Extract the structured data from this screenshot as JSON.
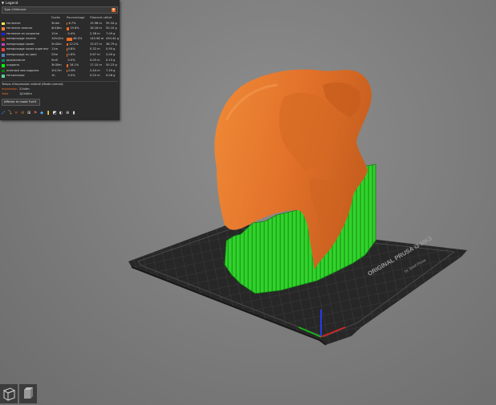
{
  "legend": {
    "title": "Legend",
    "view_type": "Type d'élément",
    "columns": {
      "time": "Durée",
      "percent": "Pourcentage",
      "length": "Filament utilisé"
    },
    "rows": [
      {
        "name": "Périmètre",
        "color": "#ffe64d",
        "time": "3h4m",
        "percent": "6.7%",
        "bar": 0.067,
        "length": "19.98 m",
        "weight": "59.34 g"
      },
      {
        "name": "Périmètre externe",
        "color": "#ff7d38",
        "time": "4h18m",
        "percent": "19.6%",
        "bar": 0.196,
        "length": "16.16 m",
        "weight": "50.10 g"
      },
      {
        "name": "Périmètre en surplomb",
        "color": "#1f1fff",
        "time": "12m",
        "percent": "0.4%",
        "bar": 0.004,
        "length": "2.38 m",
        "weight": "7.09 g"
      },
      {
        "name": "Remplissage interne",
        "color": "#b03029",
        "time": "10h12m",
        "percent": "46.5%",
        "bar": 0.465,
        "length": "145.56 m",
        "weight": "434.44 g"
      },
      {
        "name": "Remplissage solide",
        "color": "#d23cd2",
        "time": "2h42m",
        "percent": "12.2%",
        "bar": 0.122,
        "length": "13.07 m",
        "weight": "38.79 g"
      },
      {
        "name": "Remplissage solide supérieur",
        "color": "#f04040",
        "time": "11m",
        "percent": "0.8%",
        "bar": 0.008,
        "length": "0.32 m",
        "weight": "0.95 g"
      },
      {
        "name": "Remplissage du pont",
        "color": "#4d80ba",
        "time": "23m",
        "percent": "1.8%",
        "bar": 0.018,
        "length": "0.67 m",
        "weight": "2.00 g"
      },
      {
        "name": "Jupe/Bordure",
        "color": "#00876e",
        "time": "5m5",
        "percent": "0.0%",
        "bar": 0.0,
        "length": "0.05 m",
        "weight": "0.15 g"
      },
      {
        "name": "Supports",
        "color": "#00ff00",
        "time": "3h30m",
        "percent": "16.1%",
        "bar": 0.161,
        "length": "17.10 m",
        "weight": "50.23 g"
      },
      {
        "name": "Interface des supports",
        "color": "#008000",
        "time": "1h17m",
        "percent": "2.8%",
        "bar": 0.028,
        "length": "2.44 m",
        "weight": "7.29 g"
      },
      {
        "name": "Personnalisé",
        "color": "#5ed194",
        "time": "1h",
        "percent": "0.0%",
        "bar": 0.0,
        "length": "0.02 m",
        "weight": "0.06 g"
      }
    ],
    "estimated_time_label": "Temps d'impression estimé (Mode normal):",
    "print_label": "Impression",
    "print_value": "21h4m",
    "total_label": "Total",
    "total_value": "1j2h40m",
    "show_button": "Afficher le mode Furtif",
    "tools": [
      "travel-icon",
      "wipe-icon",
      "retractions-icon",
      "deretractions-icon",
      "seams-icon",
      "tool-changes-icon",
      "color-changes-icon",
      "pause-icon",
      "custom-gcode-icon",
      "shells-icon",
      "tool-marker-icon",
      "settings-icon"
    ]
  },
  "bed": {
    "label": "ORIGINAL PRUSA i3 MK3",
    "sublabel": "by Josef Prusa"
  },
  "colors": {
    "model_orange": "#e6772a",
    "support_green": "#2fd42a",
    "bed": "#2a2a2a",
    "accent": "#ed6b21"
  },
  "view_cubes": [
    "perspective-cube-icon",
    "orthographic-cube-icon"
  ]
}
